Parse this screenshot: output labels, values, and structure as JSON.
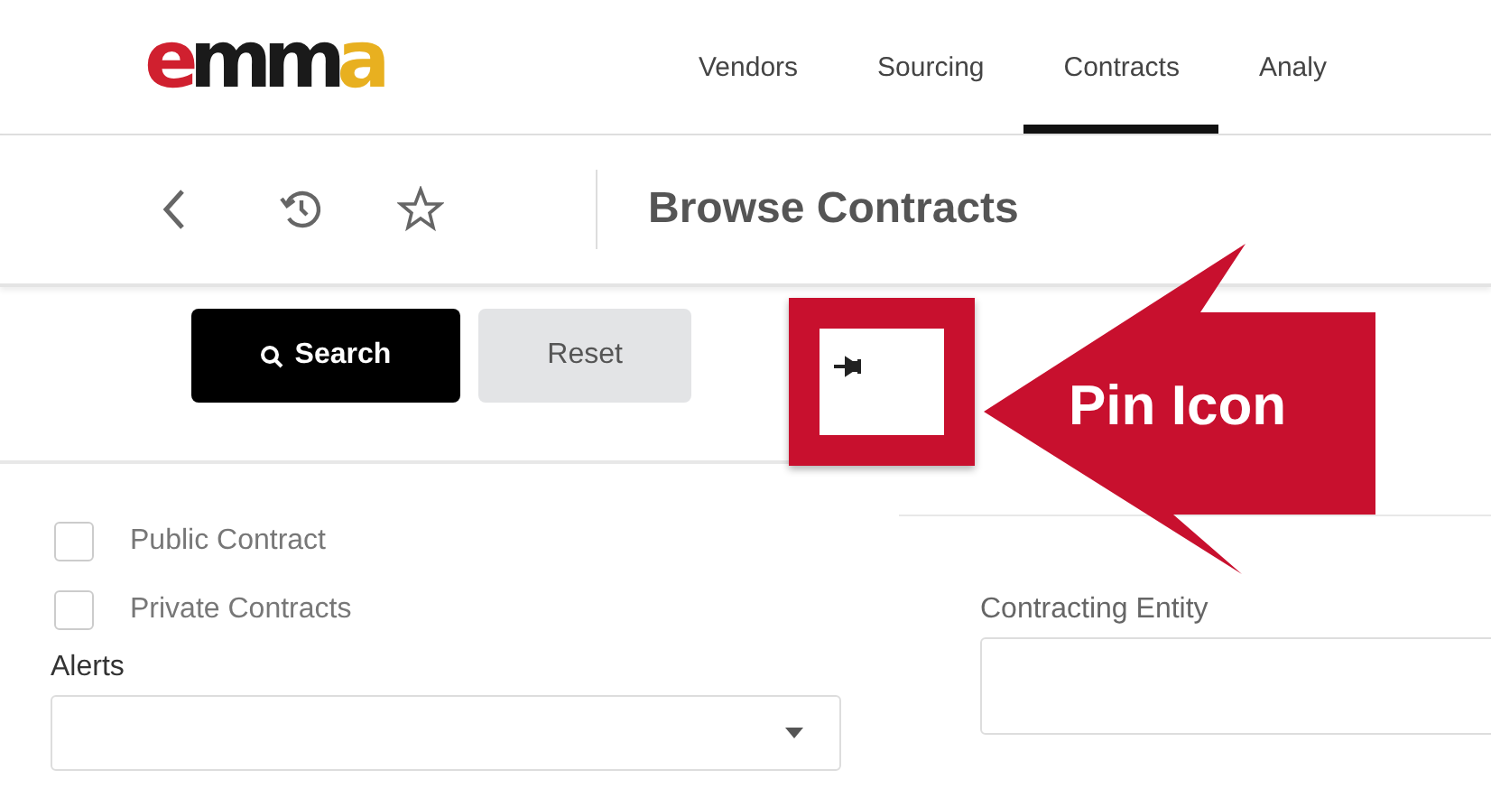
{
  "logo": {
    "text": "emma"
  },
  "nav_tabs": [
    {
      "label": "Vendors",
      "selected": false
    },
    {
      "label": "Sourcing",
      "selected": false
    },
    {
      "label": "Contracts",
      "selected": true
    },
    {
      "label": "Analy",
      "selected": false
    }
  ],
  "toolbar": {
    "title": "Browse Contracts"
  },
  "filter_buttons": [
    {
      "label": "Search",
      "kind": "primary"
    },
    {
      "label": "Reset",
      "kind": "secondary"
    }
  ],
  "annotation": {
    "label": "Pin Icon"
  },
  "checkboxes": [
    {
      "label": "Public Contract",
      "checked": false
    },
    {
      "label": "Private Contracts",
      "checked": false
    }
  ],
  "alerts": {
    "label": "Alerts"
  },
  "contracting_entity": {
    "label": "Contracting Entity"
  }
}
